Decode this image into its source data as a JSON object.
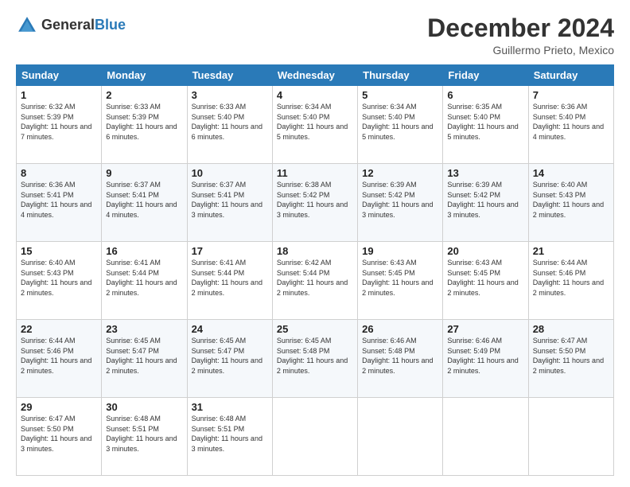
{
  "logo": {
    "general": "General",
    "blue": "Blue"
  },
  "header": {
    "month": "December 2024",
    "location": "Guillermo Prieto, Mexico"
  },
  "weekdays": [
    "Sunday",
    "Monday",
    "Tuesday",
    "Wednesday",
    "Thursday",
    "Friday",
    "Saturday"
  ],
  "weeks": [
    [
      {
        "day": "1",
        "sunrise": "6:32 AM",
        "sunset": "5:39 PM",
        "daylight": "11 hours and 7 minutes."
      },
      {
        "day": "2",
        "sunrise": "6:33 AM",
        "sunset": "5:39 PM",
        "daylight": "11 hours and 6 minutes."
      },
      {
        "day": "3",
        "sunrise": "6:33 AM",
        "sunset": "5:40 PM",
        "daylight": "11 hours and 6 minutes."
      },
      {
        "day": "4",
        "sunrise": "6:34 AM",
        "sunset": "5:40 PM",
        "daylight": "11 hours and 5 minutes."
      },
      {
        "day": "5",
        "sunrise": "6:34 AM",
        "sunset": "5:40 PM",
        "daylight": "11 hours and 5 minutes."
      },
      {
        "day": "6",
        "sunrise": "6:35 AM",
        "sunset": "5:40 PM",
        "daylight": "11 hours and 5 minutes."
      },
      {
        "day": "7",
        "sunrise": "6:36 AM",
        "sunset": "5:40 PM",
        "daylight": "11 hours and 4 minutes."
      }
    ],
    [
      {
        "day": "8",
        "sunrise": "6:36 AM",
        "sunset": "5:41 PM",
        "daylight": "11 hours and 4 minutes."
      },
      {
        "day": "9",
        "sunrise": "6:37 AM",
        "sunset": "5:41 PM",
        "daylight": "11 hours and 4 minutes."
      },
      {
        "day": "10",
        "sunrise": "6:37 AM",
        "sunset": "5:41 PM",
        "daylight": "11 hours and 3 minutes."
      },
      {
        "day": "11",
        "sunrise": "6:38 AM",
        "sunset": "5:42 PM",
        "daylight": "11 hours and 3 minutes."
      },
      {
        "day": "12",
        "sunrise": "6:39 AM",
        "sunset": "5:42 PM",
        "daylight": "11 hours and 3 minutes."
      },
      {
        "day": "13",
        "sunrise": "6:39 AM",
        "sunset": "5:42 PM",
        "daylight": "11 hours and 3 minutes."
      },
      {
        "day": "14",
        "sunrise": "6:40 AM",
        "sunset": "5:43 PM",
        "daylight": "11 hours and 2 minutes."
      }
    ],
    [
      {
        "day": "15",
        "sunrise": "6:40 AM",
        "sunset": "5:43 PM",
        "daylight": "11 hours and 2 minutes."
      },
      {
        "day": "16",
        "sunrise": "6:41 AM",
        "sunset": "5:44 PM",
        "daylight": "11 hours and 2 minutes."
      },
      {
        "day": "17",
        "sunrise": "6:41 AM",
        "sunset": "5:44 PM",
        "daylight": "11 hours and 2 minutes."
      },
      {
        "day": "18",
        "sunrise": "6:42 AM",
        "sunset": "5:44 PM",
        "daylight": "11 hours and 2 minutes."
      },
      {
        "day": "19",
        "sunrise": "6:43 AM",
        "sunset": "5:45 PM",
        "daylight": "11 hours and 2 minutes."
      },
      {
        "day": "20",
        "sunrise": "6:43 AM",
        "sunset": "5:45 PM",
        "daylight": "11 hours and 2 minutes."
      },
      {
        "day": "21",
        "sunrise": "6:44 AM",
        "sunset": "5:46 PM",
        "daylight": "11 hours and 2 minutes."
      }
    ],
    [
      {
        "day": "22",
        "sunrise": "6:44 AM",
        "sunset": "5:46 PM",
        "daylight": "11 hours and 2 minutes."
      },
      {
        "day": "23",
        "sunrise": "6:45 AM",
        "sunset": "5:47 PM",
        "daylight": "11 hours and 2 minutes."
      },
      {
        "day": "24",
        "sunrise": "6:45 AM",
        "sunset": "5:47 PM",
        "daylight": "11 hours and 2 minutes."
      },
      {
        "day": "25",
        "sunrise": "6:45 AM",
        "sunset": "5:48 PM",
        "daylight": "11 hours and 2 minutes."
      },
      {
        "day": "26",
        "sunrise": "6:46 AM",
        "sunset": "5:48 PM",
        "daylight": "11 hours and 2 minutes."
      },
      {
        "day": "27",
        "sunrise": "6:46 AM",
        "sunset": "5:49 PM",
        "daylight": "11 hours and 2 minutes."
      },
      {
        "day": "28",
        "sunrise": "6:47 AM",
        "sunset": "5:50 PM",
        "daylight": "11 hours and 2 minutes."
      }
    ],
    [
      {
        "day": "29",
        "sunrise": "6:47 AM",
        "sunset": "5:50 PM",
        "daylight": "11 hours and 3 minutes."
      },
      {
        "day": "30",
        "sunrise": "6:48 AM",
        "sunset": "5:51 PM",
        "daylight": "11 hours and 3 minutes."
      },
      {
        "day": "31",
        "sunrise": "6:48 AM",
        "sunset": "5:51 PM",
        "daylight": "11 hours and 3 minutes."
      },
      null,
      null,
      null,
      null
    ]
  ],
  "labels": {
    "sunrise": "Sunrise:",
    "sunset": "Sunset:",
    "daylight": "Daylight:"
  }
}
